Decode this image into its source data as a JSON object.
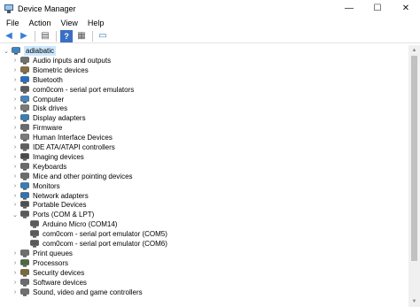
{
  "window": {
    "title": "Device Manager",
    "controls": [
      "—",
      "☐",
      "✕"
    ]
  },
  "menu": [
    "File",
    "Action",
    "View",
    "Help"
  ],
  "toolbar": [
    {
      "name": "back-icon",
      "glyph": "◀",
      "color": "#3b7dd8"
    },
    {
      "name": "forward-icon",
      "glyph": "▶",
      "color": "#3b7dd8"
    },
    {
      "sep": true
    },
    {
      "name": "properties-icon",
      "glyph": "▤",
      "color": "#555555"
    },
    {
      "sep": true
    },
    {
      "name": "help-icon",
      "glyph": "?",
      "color": "#ffffff",
      "bg": "#3b6fc4"
    },
    {
      "name": "view-icon",
      "glyph": "▦",
      "color": "#555555"
    },
    {
      "sep": true
    },
    {
      "name": "scan-hardware-icon",
      "glyph": "▭",
      "color": "#2a7ab8"
    }
  ],
  "tree": {
    "root": "adiabatic",
    "items": [
      {
        "label": "Audio inputs and outputs",
        "icon": "speaker-icon",
        "color": "#707070",
        "expanded": false
      },
      {
        "label": "Biometric devices",
        "icon": "fingerprint-icon",
        "color": "#8a6d3b",
        "expanded": false
      },
      {
        "label": "Bluetooth",
        "icon": "bluetooth-icon",
        "color": "#1a6fd1",
        "expanded": false
      },
      {
        "label": "com0com - serial port emulators",
        "icon": "device-icon",
        "color": "#5a5a5a",
        "expanded": false
      },
      {
        "label": "Computer",
        "icon": "computer-icon",
        "color": "#3e86c9",
        "expanded": false
      },
      {
        "label": "Disk drives",
        "icon": "disk-icon",
        "color": "#7a7a7a",
        "expanded": false
      },
      {
        "label": "Display adapters",
        "icon": "display-icon",
        "color": "#2f7fc1",
        "expanded": false
      },
      {
        "label": "Firmware",
        "icon": "chip-icon",
        "color": "#6a6a6a",
        "expanded": false
      },
      {
        "label": "Human Interface Devices",
        "icon": "hid-icon",
        "color": "#7b7b7b",
        "expanded": false
      },
      {
        "label": "IDE ATA/ATAPI controllers",
        "icon": "controller-icon",
        "color": "#5e5e5e",
        "expanded": false
      },
      {
        "label": "Imaging devices",
        "icon": "camera-icon",
        "color": "#4a4a4a",
        "expanded": false
      },
      {
        "label": "Keyboards",
        "icon": "keyboard-icon",
        "color": "#6b6b6b",
        "expanded": false
      },
      {
        "label": "Mice and other pointing devices",
        "icon": "mouse-icon",
        "color": "#6b6b6b",
        "expanded": false
      },
      {
        "label": "Monitors",
        "icon": "monitor-icon",
        "color": "#2f7fc1",
        "expanded": false
      },
      {
        "label": "Network adapters",
        "icon": "network-icon",
        "color": "#2c73b8",
        "expanded": false
      },
      {
        "label": "Portable Devices",
        "icon": "portable-icon",
        "color": "#4f4f4f",
        "expanded": false
      },
      {
        "label": "Ports (COM & LPT)",
        "icon": "port-icon",
        "color": "#5a5a5a",
        "expanded": true,
        "children": [
          {
            "label": "Arduino Micro (COM14)",
            "icon": "port-icon",
            "color": "#5a5a5a"
          },
          {
            "label": "com0com - serial port emulator (COM5)",
            "icon": "port-icon",
            "color": "#5a5a5a"
          },
          {
            "label": "com0com - serial port emulator (COM6)",
            "icon": "port-icon",
            "color": "#5a5a5a"
          }
        ]
      },
      {
        "label": "Print queues",
        "icon": "printer-icon",
        "color": "#6f6f6f",
        "expanded": false
      },
      {
        "label": "Processors",
        "icon": "processor-icon",
        "color": "#4a6a3b",
        "expanded": false
      },
      {
        "label": "Security devices",
        "icon": "security-icon",
        "color": "#7c6a2f",
        "expanded": false
      },
      {
        "label": "Software devices",
        "icon": "software-icon",
        "color": "#6b6b6b",
        "expanded": false
      },
      {
        "label": "Sound, video and game controllers",
        "icon": "sound-icon",
        "color": "#707070",
        "expanded": false
      }
    ]
  }
}
